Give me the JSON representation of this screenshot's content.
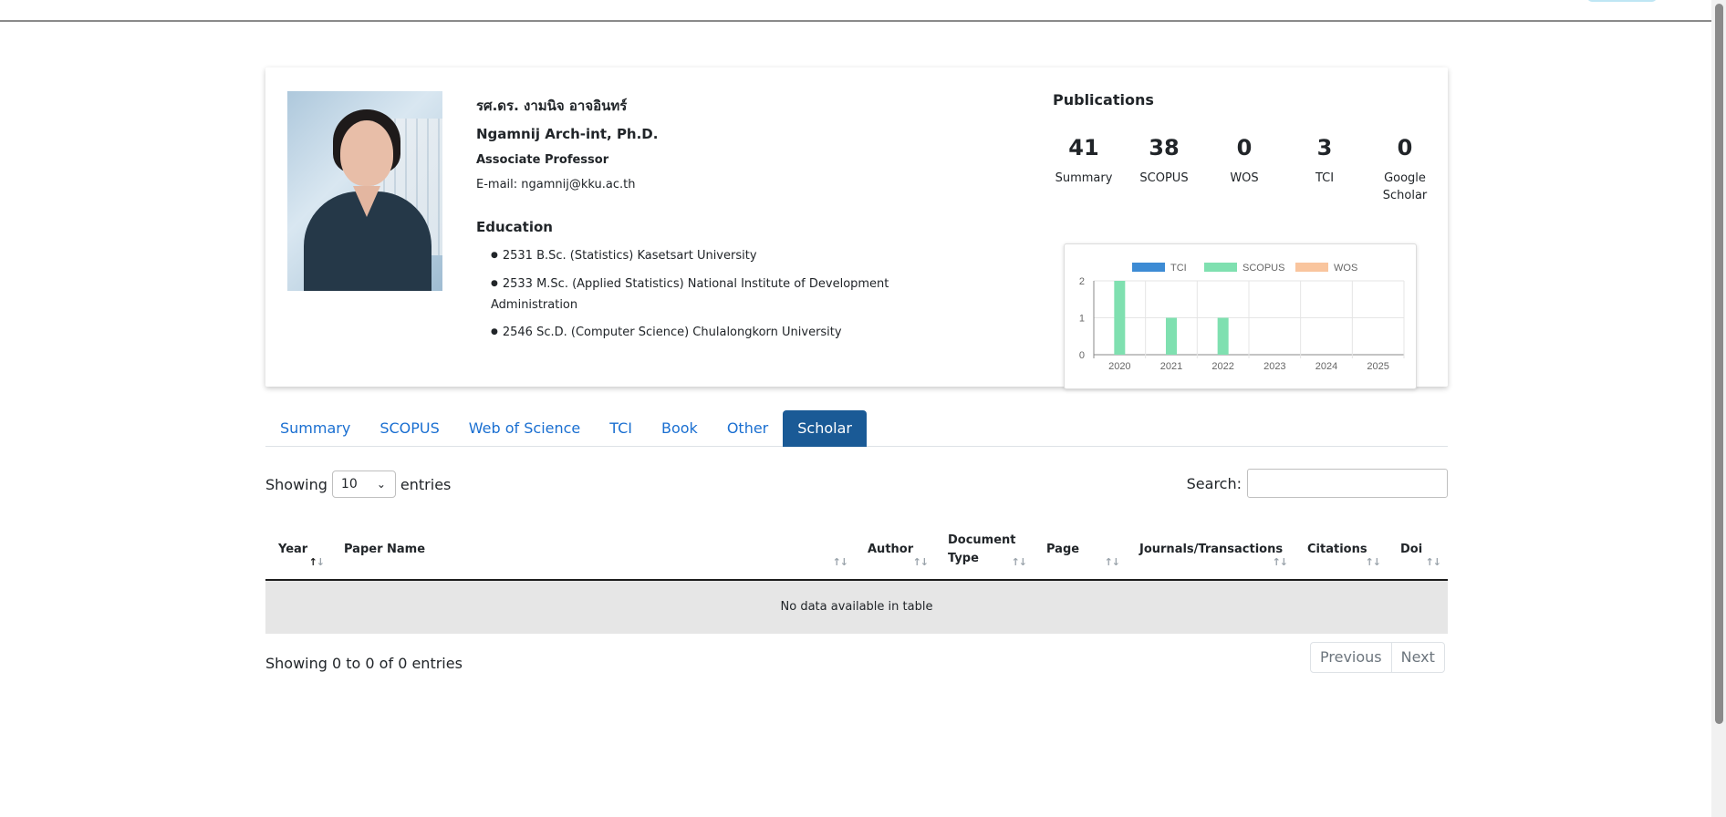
{
  "profile": {
    "name_th": "รศ.ดร. งามนิจ อาจอินทร์",
    "name_en": "Ngamnij Arch-int, Ph.D.",
    "position": "Associate Professor",
    "email": "E-mail: ngamnij@kku.ac.th",
    "education_title": "Education",
    "education": [
      "2531 B.Sc. (Statistics) Kasetsart University",
      "2533 M.Sc. (Applied Statistics) National Institute of Development Administration",
      "2546 Sc.D. (Computer Science) Chulalongkorn University"
    ]
  },
  "publications": {
    "title": "Publications",
    "stats": [
      {
        "value": "41",
        "label": "Summary"
      },
      {
        "value": "38",
        "label": "SCOPUS"
      },
      {
        "value": "0",
        "label": "WOS"
      },
      {
        "value": "3",
        "label": "TCI"
      },
      {
        "value": "0",
        "label": "Google Scholar"
      }
    ]
  },
  "chart_data": {
    "type": "bar",
    "categories": [
      "2020",
      "2021",
      "2022",
      "2023",
      "2024",
      "2025"
    ],
    "series": [
      {
        "name": "TCI",
        "color": "#3d8bd4",
        "values": [
          0,
          0,
          0,
          0,
          0,
          0
        ]
      },
      {
        "name": "SCOPUS",
        "color": "#7fe0b0",
        "values": [
          2,
          1,
          1,
          0,
          0,
          0
        ]
      },
      {
        "name": "WOS",
        "color": "#f9c59e",
        "values": [
          0,
          0,
          0,
          0,
          0,
          0
        ]
      }
    ],
    "yticks": [
      "0",
      "1",
      "2"
    ],
    "ylim": [
      0,
      2
    ],
    "legend": "top",
    "grid": true
  },
  "tabs": [
    {
      "label": "Summary",
      "active": false
    },
    {
      "label": "SCOPUS",
      "active": false
    },
    {
      "label": "Web of Science",
      "active": false
    },
    {
      "label": "TCI",
      "active": false
    },
    {
      "label": "Book",
      "active": false
    },
    {
      "label": "Other",
      "active": false
    },
    {
      "label": "Scholar",
      "active": true
    }
  ],
  "table_controls": {
    "showing_label": "Showing",
    "page_size": "10",
    "entries_label": "entries",
    "search_label": "Search:",
    "search_value": ""
  },
  "table": {
    "columns": [
      "Year",
      "Paper Name",
      "Author",
      "Document Type",
      "Page",
      "Journals/Transactions",
      "Citations",
      "Doi"
    ],
    "empty_message": "No data available in table",
    "info": "Showing 0 to 0 of 0 entries",
    "prev_label": "Previous",
    "next_label": "Next"
  }
}
